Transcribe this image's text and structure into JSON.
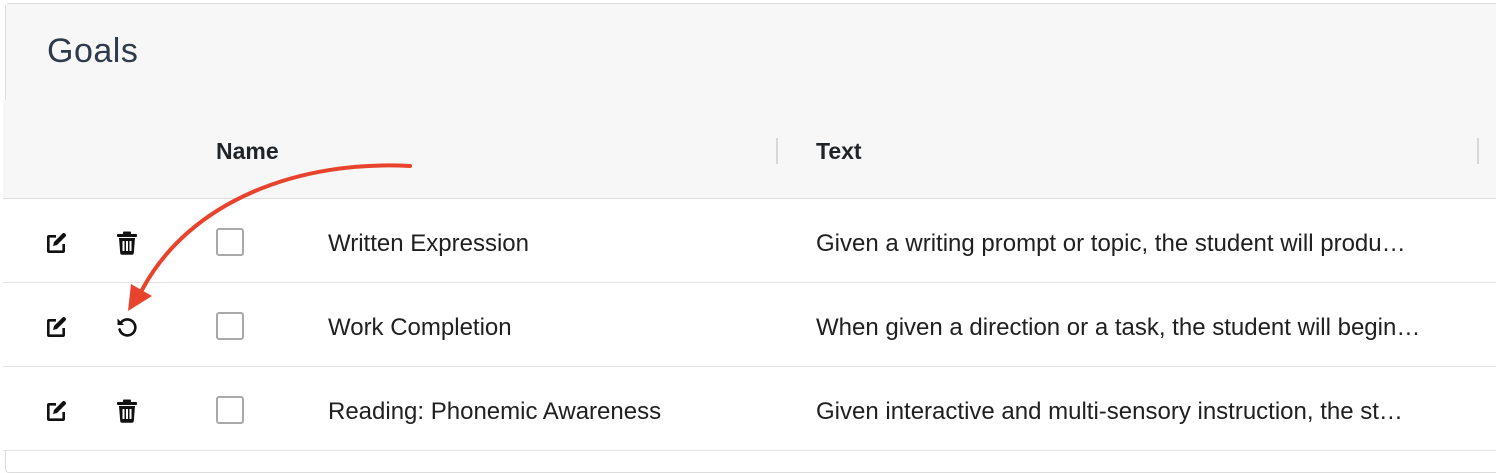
{
  "page": {
    "title": "Goals"
  },
  "grid": {
    "columns": [
      {
        "label": "Name"
      },
      {
        "label": "Text"
      }
    ],
    "rows": [
      {
        "name": "Written Expression",
        "text": "Given a writing prompt or topic, the student will produ…",
        "action": "delete",
        "action_icon": "trash-icon",
        "checked": false
      },
      {
        "name": "Work Completion",
        "text": "When given a direction or a task, the student will begin…",
        "action": "restore",
        "action_icon": "undo-icon",
        "checked": false
      },
      {
        "name": "Reading: Phonemic Awareness",
        "text": "Given interactive and multi-sensory instruction, the st…",
        "action": "delete",
        "action_icon": "trash-icon",
        "checked": false
      }
    ]
  },
  "annotation": {
    "arrow_color": "#e8442d",
    "points_to": "restore-button"
  },
  "colors": {
    "header_bg": "#f7f7f7",
    "border": "#dcdcdc",
    "text": "#202020",
    "title": "#2f3b4c"
  }
}
